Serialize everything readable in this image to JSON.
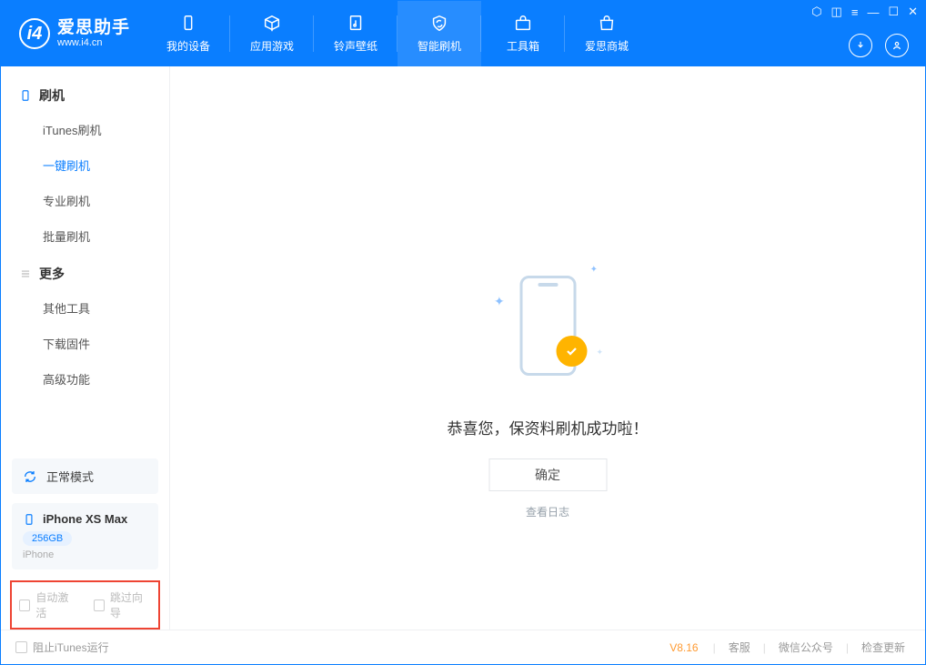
{
  "app": {
    "name_cn": "爱思助手",
    "name_en": "www.i4.cn"
  },
  "nav": {
    "items": [
      {
        "label": "我的设备"
      },
      {
        "label": "应用游戏"
      },
      {
        "label": "铃声壁纸"
      },
      {
        "label": "智能刷机"
      },
      {
        "label": "工具箱"
      },
      {
        "label": "爱思商城"
      }
    ]
  },
  "sidebar": {
    "group1": {
      "title": "刷机",
      "items": [
        "iTunes刷机",
        "一键刷机",
        "专业刷机",
        "批量刷机"
      ]
    },
    "group2": {
      "title": "更多",
      "items": [
        "其他工具",
        "下载固件",
        "高级功能"
      ]
    }
  },
  "device": {
    "mode": "正常模式",
    "name": "iPhone XS Max",
    "storage": "256GB",
    "type": "iPhone"
  },
  "options": {
    "auto_activate": "自动激活",
    "skip_guide": "跳过向导"
  },
  "result": {
    "message": "恭喜您，保资料刷机成功啦！",
    "ok": "确定",
    "view_log": "查看日志"
  },
  "footer": {
    "block_itunes": "阻止iTunes运行",
    "version": "V8.16",
    "links": [
      "客服",
      "微信公众号",
      "检查更新"
    ]
  }
}
